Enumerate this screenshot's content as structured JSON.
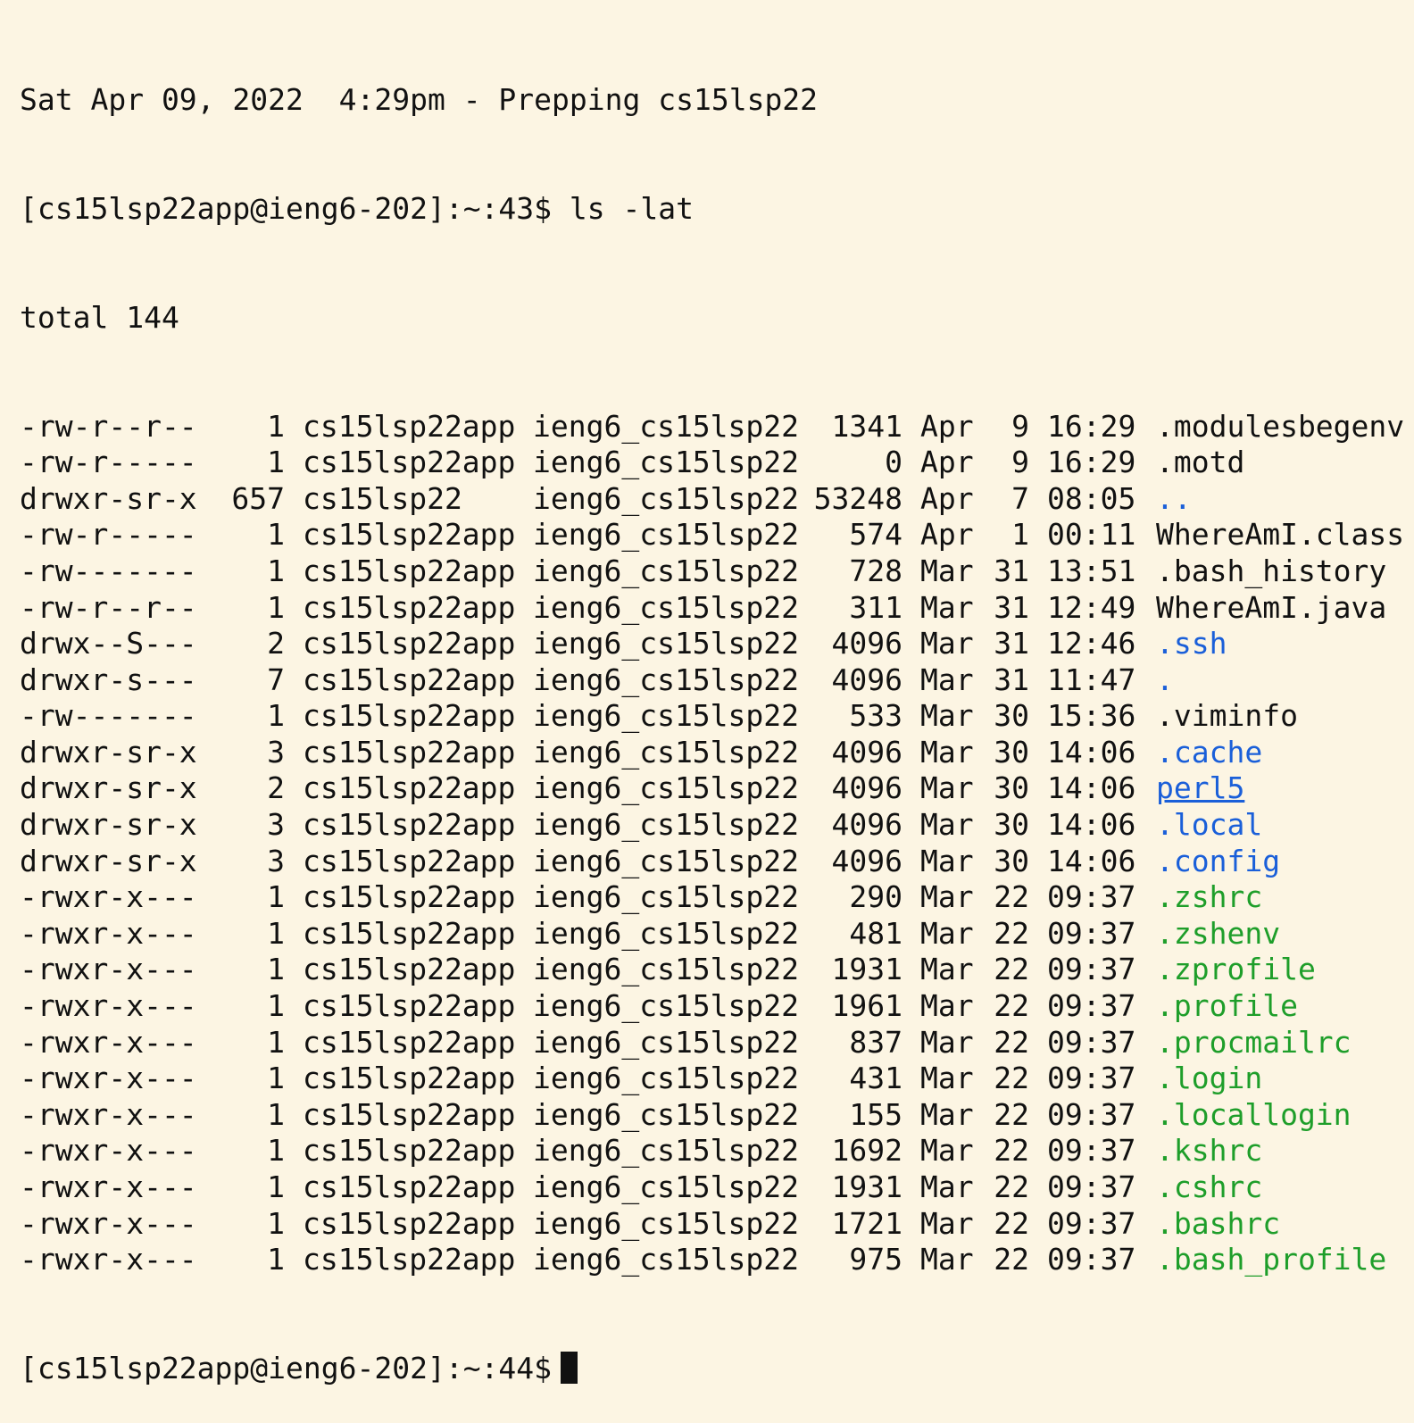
{
  "colors": {
    "background": "#fcf5e3",
    "text": "#111111",
    "directory": "#1a5fd9",
    "executable": "#1e9e2a"
  },
  "banner": "Sat Apr 09, 2022  4:29pm - Prepping cs15lsp22",
  "prompt1": {
    "prompt": "[cs15lsp22app@ieng6-202]:~:43$",
    "command": "ls -lat"
  },
  "total": "total 144",
  "listing": [
    {
      "perm": "-rw-r--r--",
      "links": "1",
      "owner": "cs15lsp22app",
      "group": "ieng6_cs15lsp22",
      "size": "1341",
      "month": "Apr",
      "day": "9",
      "time": "16:29",
      "name": ".modulesbegenv",
      "kind": "file"
    },
    {
      "perm": "-rw-r-----",
      "links": "1",
      "owner": "cs15lsp22app",
      "group": "ieng6_cs15lsp22",
      "size": "0",
      "month": "Apr",
      "day": "9",
      "time": "16:29",
      "name": ".motd",
      "kind": "file"
    },
    {
      "perm": "drwxr-sr-x",
      "links": "657",
      "owner": "cs15lsp22",
      "group": "ieng6_cs15lsp22",
      "size": "53248",
      "month": "Apr",
      "day": "7",
      "time": "08:05",
      "name": "..",
      "kind": "dir"
    },
    {
      "perm": "-rw-r-----",
      "links": "1",
      "owner": "cs15lsp22app",
      "group": "ieng6_cs15lsp22",
      "size": "574",
      "month": "Apr",
      "day": "1",
      "time": "00:11",
      "name": "WhereAmI.class",
      "kind": "file"
    },
    {
      "perm": "-rw-------",
      "links": "1",
      "owner": "cs15lsp22app",
      "group": "ieng6_cs15lsp22",
      "size": "728",
      "month": "Mar",
      "day": "31",
      "time": "13:51",
      "name": ".bash_history",
      "kind": "file"
    },
    {
      "perm": "-rw-r--r--",
      "links": "1",
      "owner": "cs15lsp22app",
      "group": "ieng6_cs15lsp22",
      "size": "311",
      "month": "Mar",
      "day": "31",
      "time": "12:49",
      "name": "WhereAmI.java",
      "kind": "file"
    },
    {
      "perm": "drwx--S---",
      "links": "2",
      "owner": "cs15lsp22app",
      "group": "ieng6_cs15lsp22",
      "size": "4096",
      "month": "Mar",
      "day": "31",
      "time": "12:46",
      "name": ".ssh",
      "kind": "dir"
    },
    {
      "perm": "drwxr-s---",
      "links": "7",
      "owner": "cs15lsp22app",
      "group": "ieng6_cs15lsp22",
      "size": "4096",
      "month": "Mar",
      "day": "31",
      "time": "11:47",
      "name": ".",
      "kind": "dir"
    },
    {
      "perm": "-rw-------",
      "links": "1",
      "owner": "cs15lsp22app",
      "group": "ieng6_cs15lsp22",
      "size": "533",
      "month": "Mar",
      "day": "30",
      "time": "15:36",
      "name": ".viminfo",
      "kind": "file"
    },
    {
      "perm": "drwxr-sr-x",
      "links": "3",
      "owner": "cs15lsp22app",
      "group": "ieng6_cs15lsp22",
      "size": "4096",
      "month": "Mar",
      "day": "30",
      "time": "14:06",
      "name": ".cache",
      "kind": "dir"
    },
    {
      "perm": "drwxr-sr-x",
      "links": "2",
      "owner": "cs15lsp22app",
      "group": "ieng6_cs15lsp22",
      "size": "4096",
      "month": "Mar",
      "day": "30",
      "time": "14:06",
      "name": "perl5",
      "kind": "link"
    },
    {
      "perm": "drwxr-sr-x",
      "links": "3",
      "owner": "cs15lsp22app",
      "group": "ieng6_cs15lsp22",
      "size": "4096",
      "month": "Mar",
      "day": "30",
      "time": "14:06",
      "name": ".local",
      "kind": "dir"
    },
    {
      "perm": "drwxr-sr-x",
      "links": "3",
      "owner": "cs15lsp22app",
      "group": "ieng6_cs15lsp22",
      "size": "4096",
      "month": "Mar",
      "day": "30",
      "time": "14:06",
      "name": ".config",
      "kind": "dir"
    },
    {
      "perm": "-rwxr-x---",
      "links": "1",
      "owner": "cs15lsp22app",
      "group": "ieng6_cs15lsp22",
      "size": "290",
      "month": "Mar",
      "day": "22",
      "time": "09:37",
      "name": ".zshrc",
      "kind": "exec"
    },
    {
      "perm": "-rwxr-x---",
      "links": "1",
      "owner": "cs15lsp22app",
      "group": "ieng6_cs15lsp22",
      "size": "481",
      "month": "Mar",
      "day": "22",
      "time": "09:37",
      "name": ".zshenv",
      "kind": "exec"
    },
    {
      "perm": "-rwxr-x---",
      "links": "1",
      "owner": "cs15lsp22app",
      "group": "ieng6_cs15lsp22",
      "size": "1931",
      "month": "Mar",
      "day": "22",
      "time": "09:37",
      "name": ".zprofile",
      "kind": "exec"
    },
    {
      "perm": "-rwxr-x---",
      "links": "1",
      "owner": "cs15lsp22app",
      "group": "ieng6_cs15lsp22",
      "size": "1961",
      "month": "Mar",
      "day": "22",
      "time": "09:37",
      "name": ".profile",
      "kind": "exec"
    },
    {
      "perm": "-rwxr-x---",
      "links": "1",
      "owner": "cs15lsp22app",
      "group": "ieng6_cs15lsp22",
      "size": "837",
      "month": "Mar",
      "day": "22",
      "time": "09:37",
      "name": ".procmailrc",
      "kind": "exec"
    },
    {
      "perm": "-rwxr-x---",
      "links": "1",
      "owner": "cs15lsp22app",
      "group": "ieng6_cs15lsp22",
      "size": "431",
      "month": "Mar",
      "day": "22",
      "time": "09:37",
      "name": ".login",
      "kind": "exec"
    },
    {
      "perm": "-rwxr-x---",
      "links": "1",
      "owner": "cs15lsp22app",
      "group": "ieng6_cs15lsp22",
      "size": "155",
      "month": "Mar",
      "day": "22",
      "time": "09:37",
      "name": ".locallogin",
      "kind": "exec"
    },
    {
      "perm": "-rwxr-x---",
      "links": "1",
      "owner": "cs15lsp22app",
      "group": "ieng6_cs15lsp22",
      "size": "1692",
      "month": "Mar",
      "day": "22",
      "time": "09:37",
      "name": ".kshrc",
      "kind": "exec"
    },
    {
      "perm": "-rwxr-x---",
      "links": "1",
      "owner": "cs15lsp22app",
      "group": "ieng6_cs15lsp22",
      "size": "1931",
      "month": "Mar",
      "day": "22",
      "time": "09:37",
      "name": ".cshrc",
      "kind": "exec"
    },
    {
      "perm": "-rwxr-x---",
      "links": "1",
      "owner": "cs15lsp22app",
      "group": "ieng6_cs15lsp22",
      "size": "1721",
      "month": "Mar",
      "day": "22",
      "time": "09:37",
      "name": ".bashrc",
      "kind": "exec"
    },
    {
      "perm": "-rwxr-x---",
      "links": "1",
      "owner": "cs15lsp22app",
      "group": "ieng6_cs15lsp22",
      "size": "975",
      "month": "Mar",
      "day": "22",
      "time": "09:37",
      "name": ".bash_profile",
      "kind": "exec"
    }
  ],
  "prompt2": {
    "prompt": "[cs15lsp22app@ieng6-202]:~:44$"
  }
}
